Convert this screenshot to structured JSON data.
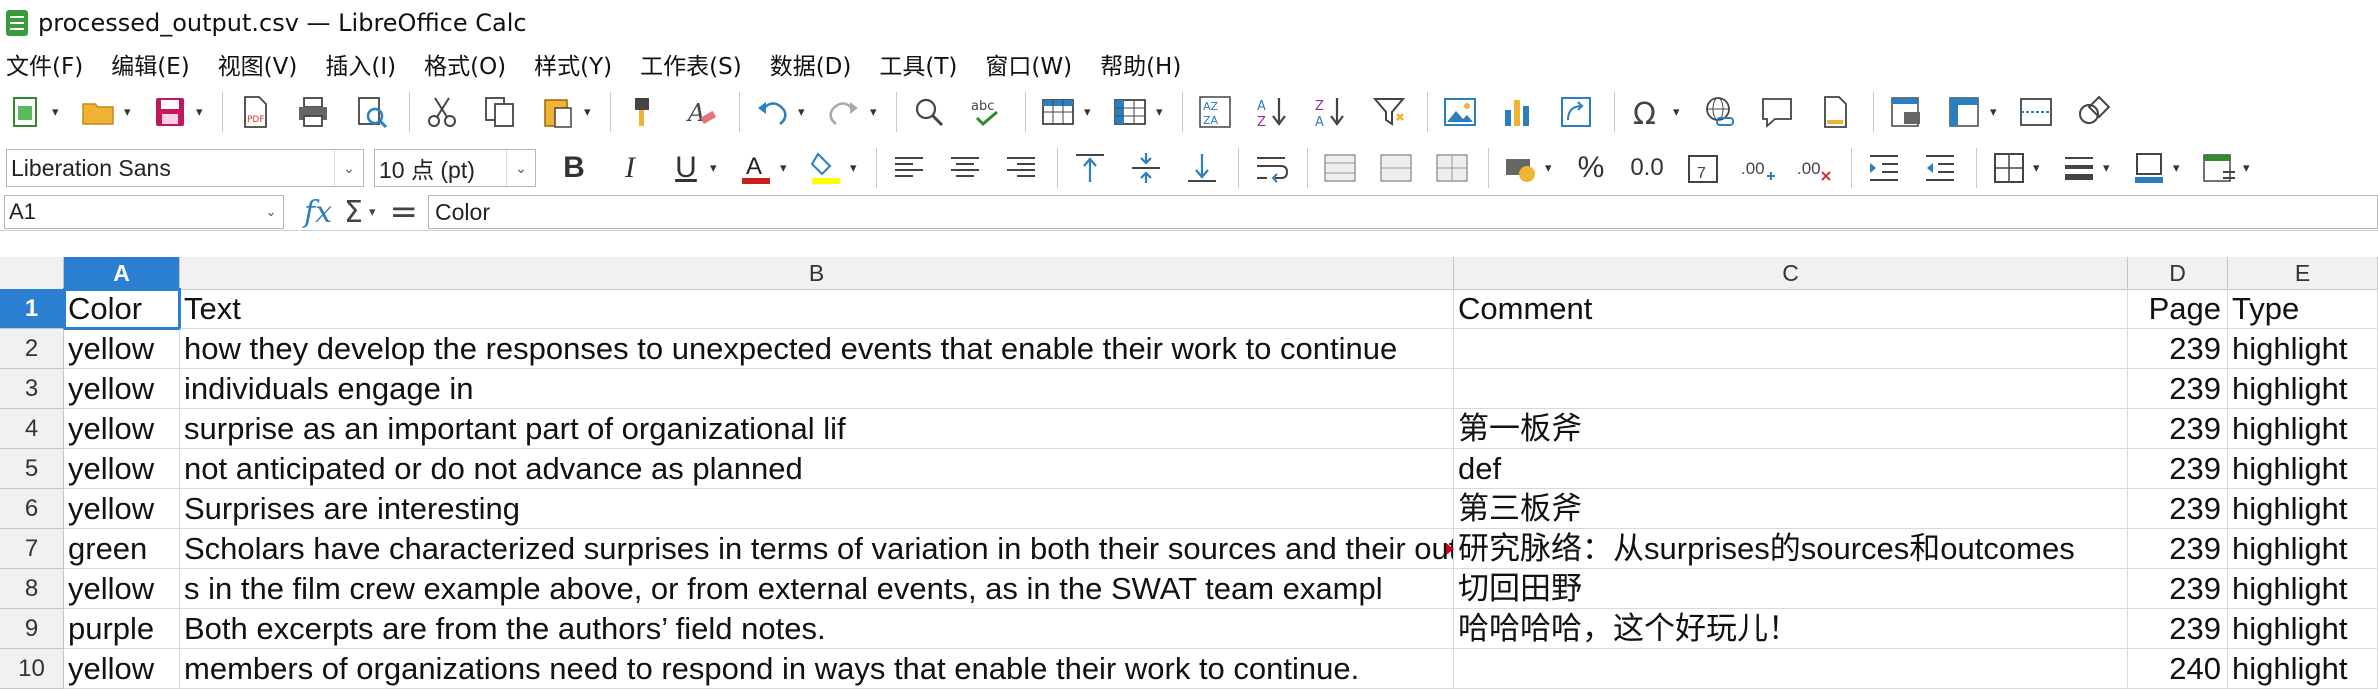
{
  "window": {
    "title": "processed_output.csv — LibreOffice Calc"
  },
  "menu": [
    "文件(F)",
    "编辑(E)",
    "视图(V)",
    "插入(I)",
    "格式(O)",
    "样式(Y)",
    "工作表(S)",
    "数据(D)",
    "工具(T)",
    "窗口(W)",
    "帮助(H)"
  ],
  "format_bar": {
    "font_name": "Liberation Sans",
    "font_size": "10 点 (pt)"
  },
  "formula_bar": {
    "cell_ref": "A1",
    "content": "Color"
  },
  "columns": [
    "A",
    "B",
    "C",
    "D",
    "E"
  ],
  "rows": [
    {
      "num": "1",
      "cells": [
        "Color",
        "Text",
        "Comment",
        "Page",
        "Type"
      ]
    },
    {
      "num": "2",
      "cells": [
        "yellow",
        "how they develop the responses to unexpected events that enable their work to continue",
        "",
        "239",
        "highlight"
      ]
    },
    {
      "num": "3",
      "cells": [
        "yellow",
        "individuals engage in",
        "",
        "239",
        "highlight"
      ]
    },
    {
      "num": "4",
      "cells": [
        "yellow",
        "surprise as an important part of organizational lif",
        "第一板斧",
        "239",
        "highlight"
      ]
    },
    {
      "num": "5",
      "cells": [
        "yellow",
        "not anticipated or do not advance as planned",
        "def",
        "239",
        "highlight"
      ]
    },
    {
      "num": "6",
      "cells": [
        "yellow",
        "Surprises are interesting",
        "第三板斧",
        "239",
        "highlight"
      ]
    },
    {
      "num": "7",
      "cells": [
        "green",
        "Scholars have characterized surprises in terms of variation in both their sources and their outcomes",
        "研究脉络：从surprises的sources和outcomes",
        "239",
        "highlight"
      ]
    },
    {
      "num": "8",
      "cells": [
        "yellow",
        "s in the film crew example above, or from external events, as in the SWAT team exampl",
        "切回田野",
        "239",
        "highlight"
      ]
    },
    {
      "num": "9",
      "cells": [
        "purple",
        "Both excerpts are from the authors’ field notes.",
        "哈哈哈哈，这个好玩儿！",
        "239",
        "highlight"
      ]
    },
    {
      "num": "10",
      "cells": [
        "yellow",
        "members of organizations need to respond in ways that enable their work to continue.",
        "",
        "240",
        "highlight"
      ]
    }
  ],
  "colors": {
    "selection": "#2b7fd0",
    "header_bg": "#f1f1f1",
    "comment_marker": "#d0021b"
  }
}
